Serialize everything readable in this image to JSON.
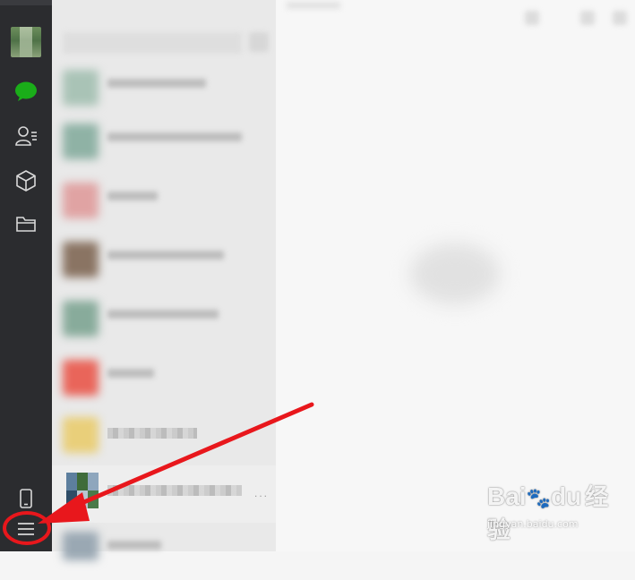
{
  "sidebar": {
    "avatar": "user-avatar",
    "items": [
      {
        "name": "chats",
        "icon": "chat-bubble-icon",
        "color": "#1aad19"
      },
      {
        "name": "contacts",
        "icon": "contacts-icon",
        "color": "#d8d8d8"
      },
      {
        "name": "favorites",
        "icon": "cube-icon",
        "color": "#d8d8d8"
      },
      {
        "name": "files",
        "icon": "folder-icon",
        "color": "#d8d8d8"
      }
    ],
    "bottom": [
      {
        "name": "phone",
        "icon": "phone-icon"
      },
      {
        "name": "menu",
        "icon": "hamburger-menu-icon"
      }
    ]
  },
  "annotation": {
    "arrow_color": "#e8171c",
    "highlight": "menu"
  },
  "watermark": {
    "brand": "Bai",
    "brand2": "du",
    "brand_cn": "经验",
    "url": "jingyan.baidu.com"
  }
}
